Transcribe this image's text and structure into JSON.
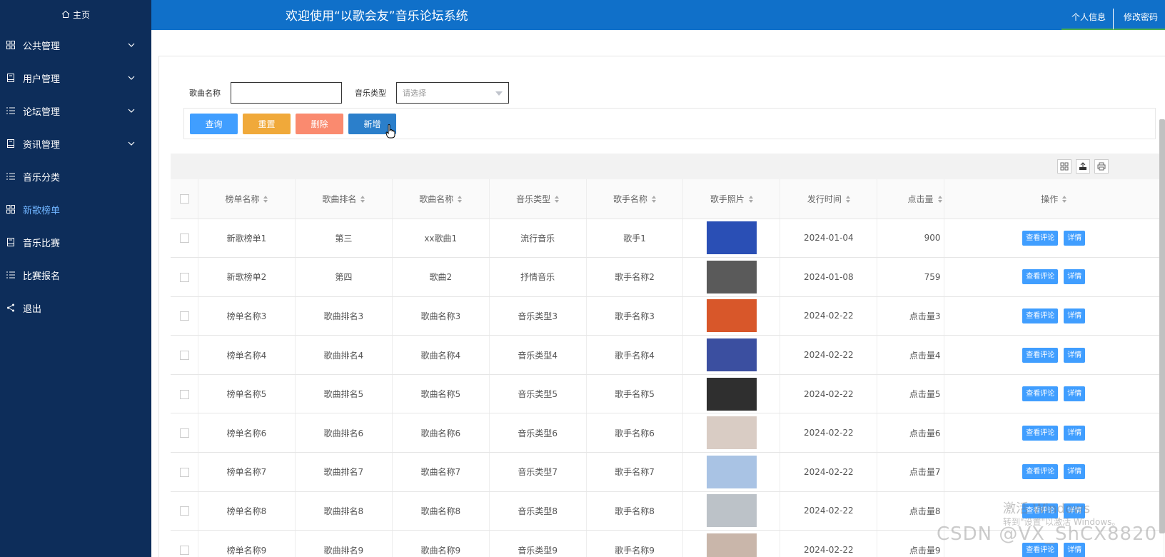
{
  "sidebar": {
    "home_label": "主页",
    "items": [
      {
        "label": "公共管理",
        "icon": "grid-icon",
        "has_children": true
      },
      {
        "label": "用户管理",
        "icon": "book-icon",
        "has_children": true
      },
      {
        "label": "论坛管理",
        "icon": "list-icon",
        "has_children": true
      },
      {
        "label": "资讯管理",
        "icon": "book-icon",
        "has_children": true
      },
      {
        "label": "音乐分类",
        "icon": "list-icon",
        "has_children": false
      },
      {
        "label": "新歌榜单",
        "icon": "grid-icon",
        "has_children": false,
        "active": true
      },
      {
        "label": "音乐比赛",
        "icon": "book-icon",
        "has_children": false
      },
      {
        "label": "比赛报名",
        "icon": "list-icon",
        "has_children": false
      },
      {
        "label": "退出",
        "icon": "share-icon",
        "has_children": false
      }
    ]
  },
  "header": {
    "title": "欢迎使用“以歌会友”音乐论坛系统",
    "links": [
      "个人信息",
      "修改密码"
    ]
  },
  "search": {
    "song_name_label": "歌曲名称",
    "song_name_value": "",
    "music_type_label": "音乐类型",
    "music_type_placeholder": "请选择"
  },
  "buttons": {
    "query": "查询",
    "reset": "重置",
    "delete": "删除",
    "add": "新增"
  },
  "table": {
    "columns": [
      "榜单名称",
      "歌曲排名",
      "歌曲名称",
      "音乐类型",
      "歌手名称",
      "歌手照片",
      "发行时间",
      "点击量",
      "操作"
    ],
    "op_labels": {
      "comments": "查看评论",
      "detail": "详情"
    },
    "rows": [
      {
        "list": "新歌榜单1",
        "rank": "第三",
        "song": "xx歌曲1",
        "type": "流行音乐",
        "singer": "歌手1",
        "date": "2024-01-04",
        "clicks": "900",
        "photo_color": "#2a4fb5"
      },
      {
        "list": "新歌榜单2",
        "rank": "第四",
        "song": "歌曲2",
        "type": "抒情音乐",
        "singer": "歌手名称2",
        "date": "2024-01-08",
        "clicks": "759",
        "photo_color": "#5a5a5a"
      },
      {
        "list": "榜单名称3",
        "rank": "歌曲排名3",
        "song": "歌曲名称3",
        "type": "音乐类型3",
        "singer": "歌手名称3",
        "date": "2024-02-22",
        "clicks": "点击量3",
        "photo_color": "#d8572a"
      },
      {
        "list": "榜单名称4",
        "rank": "歌曲排名4",
        "song": "歌曲名称4",
        "type": "音乐类型4",
        "singer": "歌手名称4",
        "date": "2024-02-22",
        "clicks": "点击量4",
        "photo_color": "#3b4fa0"
      },
      {
        "list": "榜单名称5",
        "rank": "歌曲排名5",
        "song": "歌曲名称5",
        "type": "音乐类型5",
        "singer": "歌手名称5",
        "date": "2024-02-22",
        "clicks": "点击量5",
        "photo_color": "#2f2f2f"
      },
      {
        "list": "榜单名称6",
        "rank": "歌曲排名6",
        "song": "歌曲名称6",
        "type": "音乐类型6",
        "singer": "歌手名称6",
        "date": "2024-02-22",
        "clicks": "点击量6",
        "photo_color": "#d9ccc4"
      },
      {
        "list": "榜单名称7",
        "rank": "歌曲排名7",
        "song": "歌曲名称7",
        "type": "音乐类型7",
        "singer": "歌手名称7",
        "date": "2024-02-22",
        "clicks": "点击量7",
        "photo_color": "#a9c3e4"
      },
      {
        "list": "榜单名称8",
        "rank": "歌曲排名8",
        "song": "歌曲名称8",
        "type": "音乐类型8",
        "singer": "歌手名称8",
        "date": "2024-02-22",
        "clicks": "点击量8",
        "photo_color": "#bcc2c8"
      },
      {
        "list": "榜单名称9",
        "rank": "歌曲排名9",
        "song": "歌曲名称9",
        "type": "音乐类型9",
        "singer": "歌手名称9",
        "date": "2024-02-22",
        "clicks": "点击量9",
        "photo_color": "#c9b6aa"
      }
    ]
  },
  "watermarks": {
    "activate_line1": "激活 Windows",
    "activate_line2": "转到\"设置\"以激活 Windows。",
    "csdn": "CSDN @VX_ShCX8820"
  },
  "colors": {
    "sidebar_bg": "#0d2d5a",
    "header_bg": "#1070c9",
    "primary": "#409eff",
    "warning": "#f0a93a",
    "danger": "#fa8a6f",
    "add": "#2b7fcb"
  }
}
